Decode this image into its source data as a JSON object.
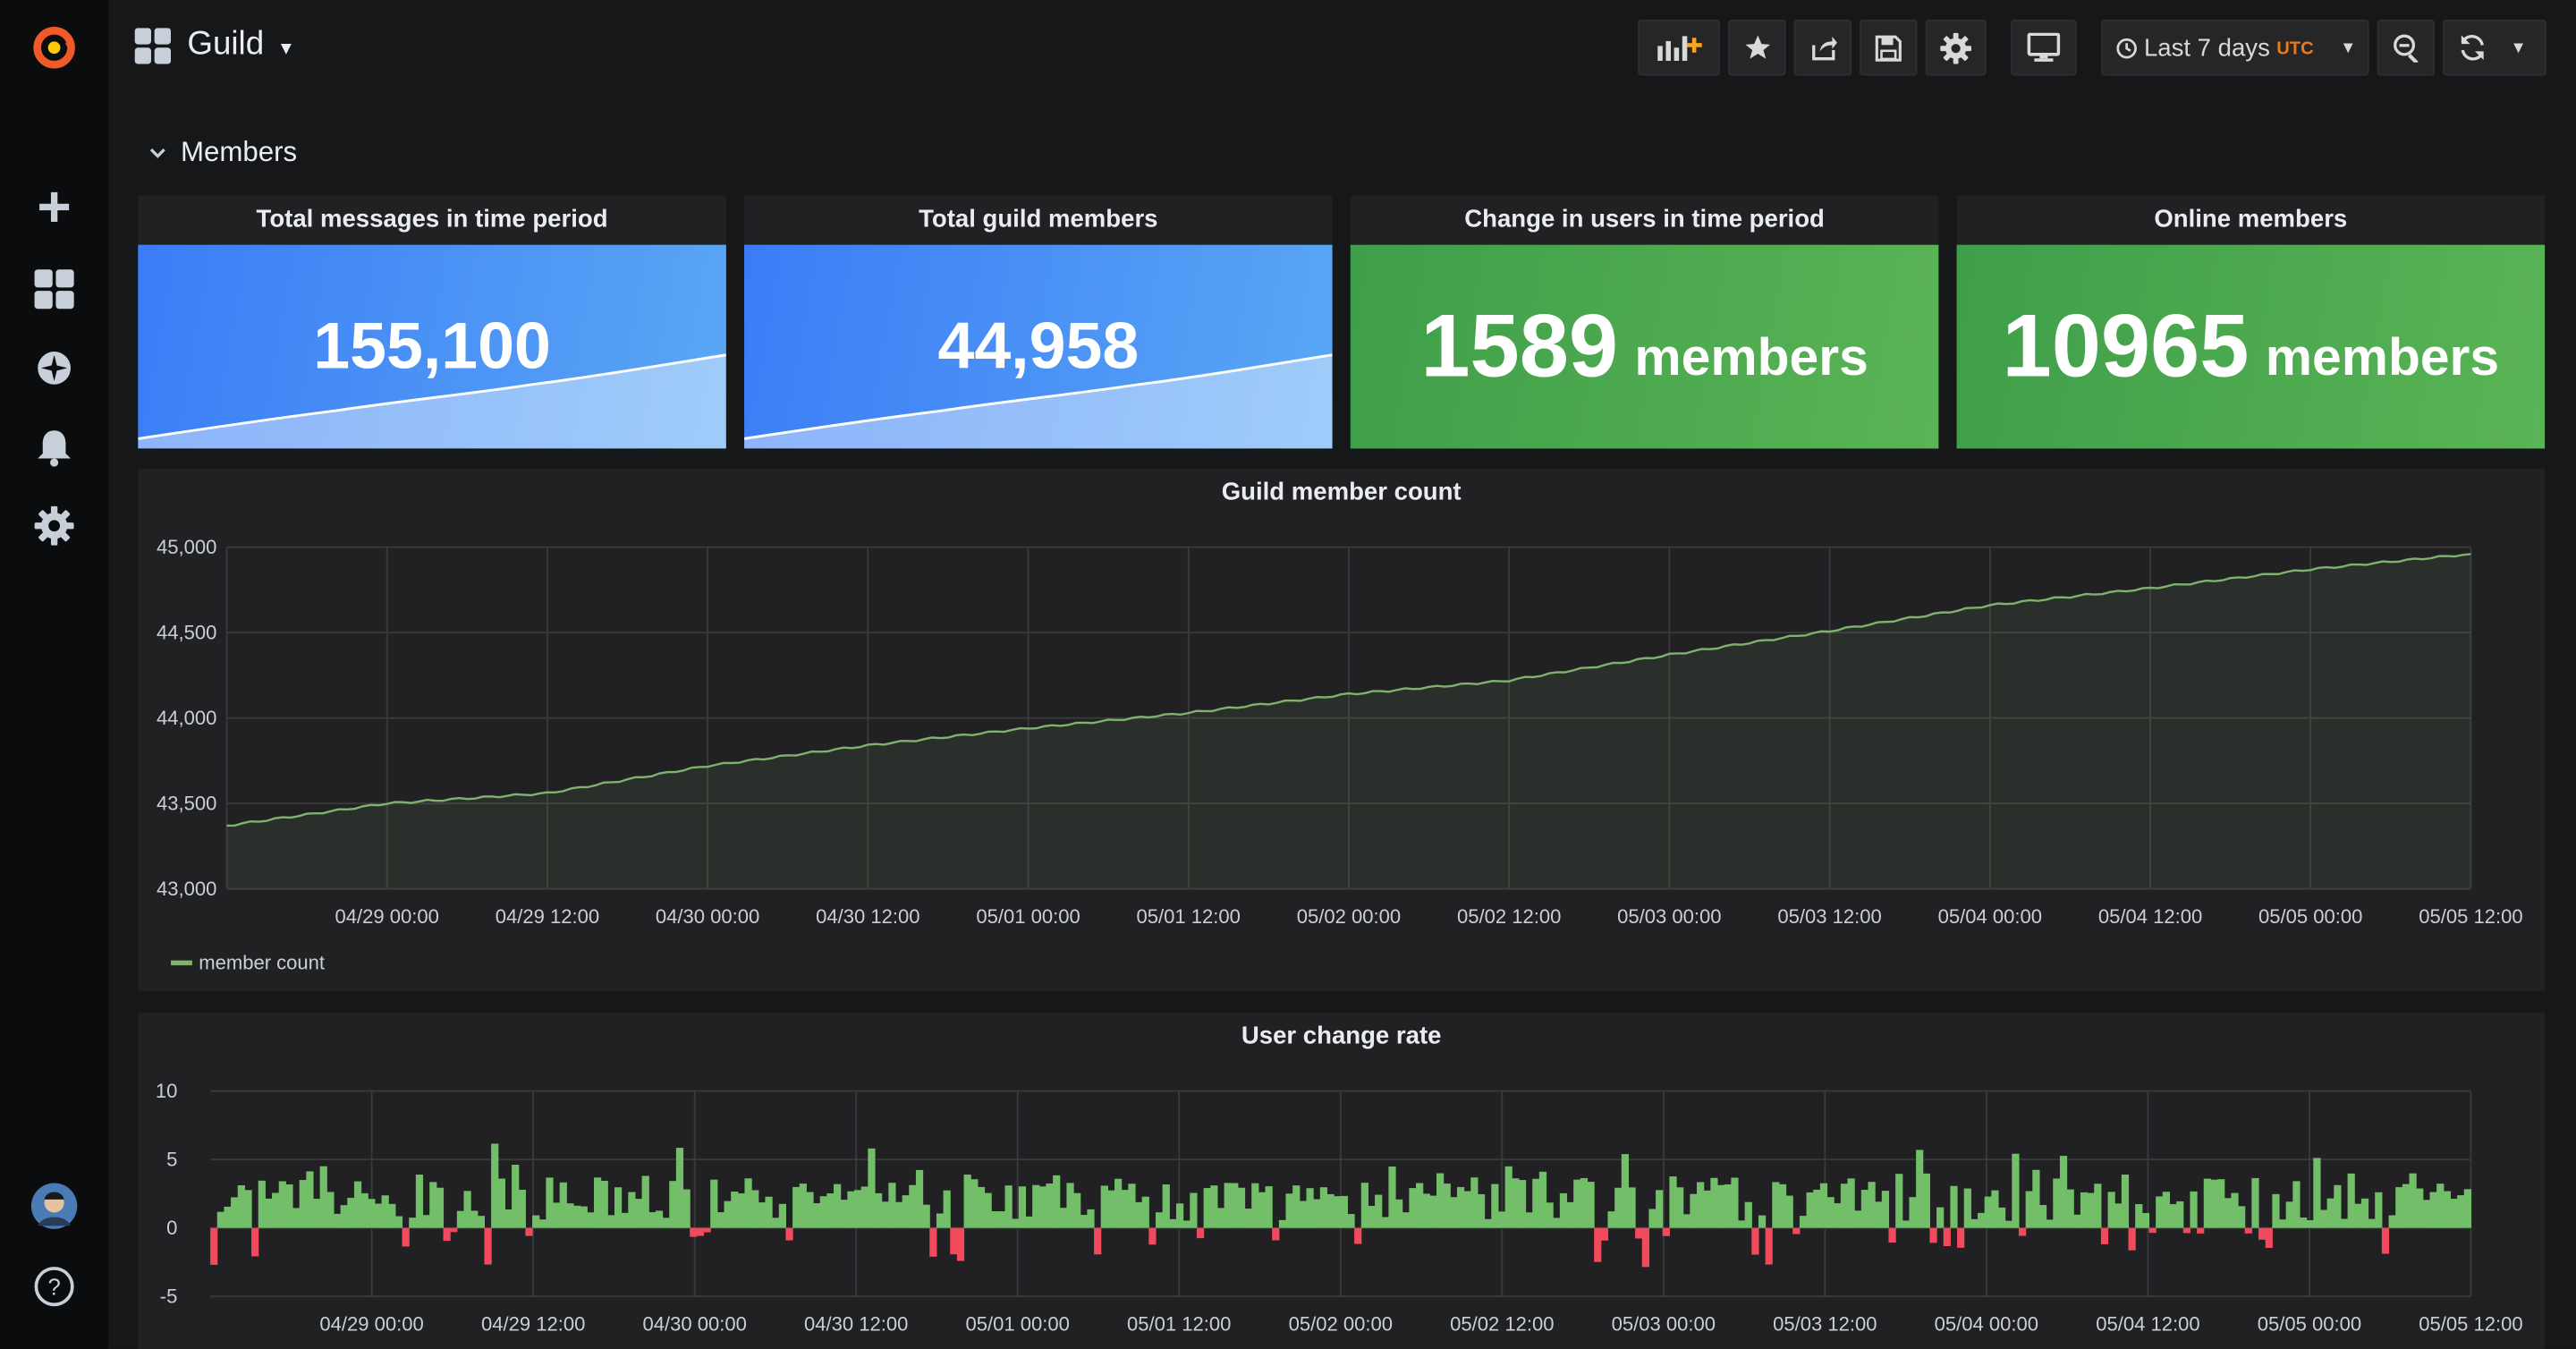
{
  "sidebar": {
    "items": [
      "grafana-logo",
      "create",
      "dashboards",
      "explore",
      "alerting",
      "configuration"
    ],
    "bottom": [
      "user-avatar",
      "help"
    ]
  },
  "header": {
    "dashboard_title": "Guild",
    "time_range": "Last 7 days",
    "timezone": "UTC"
  },
  "row": {
    "title": "Members"
  },
  "stats": [
    {
      "title": "Total messages in time period",
      "value": "155,100",
      "unit": "",
      "color": "#3d7ef5"
    },
    {
      "title": "Total guild members",
      "value": "44,958",
      "unit": "",
      "color": "#3d7ef5"
    },
    {
      "title": "Change in users in time period",
      "value": "1589",
      "unit": "members",
      "color": "#3fa14a"
    },
    {
      "title": "Online members",
      "value": "10965",
      "unit": "members",
      "color": "#3fa14a"
    }
  ],
  "colors": {
    "blue": "#3d7ef5",
    "green": "#3fa14a",
    "series_green": "#7eb26d",
    "negative": "#e02f44"
  },
  "chart_data": [
    {
      "type": "line",
      "title": "Guild member count",
      "x_ticks": [
        "04/29 00:00",
        "04/29 12:00",
        "04/30 00:00",
        "04/30 12:00",
        "05/01 00:00",
        "05/01 12:00",
        "05/02 00:00",
        "05/02 12:00",
        "05/03 00:00",
        "05/03 12:00",
        "05/04 00:00",
        "05/04 12:00",
        "05/05 00:00",
        "05/05 12:00"
      ],
      "y_ticks": [
        "45,000",
        "44,500",
        "44,000",
        "43,500",
        "43,000"
      ],
      "ylim": [
        43000,
        45000
      ],
      "xlim": [
        "04/28 12:00",
        "05/05 12:00"
      ],
      "grid": true,
      "legend": "bottom-left",
      "series": [
        {
          "name": "member count",
          "x": [
            "04/28 12:00",
            "04/29 00:00",
            "04/29 12:00",
            "04/30 00:00",
            "04/30 12:00",
            "05/01 00:00",
            "05/01 12:00",
            "05/02 00:00",
            "05/02 12:00",
            "05/03 00:00",
            "05/03 12:00",
            "05/04 00:00",
            "05/04 12:00",
            "05/05 00:00",
            "05/05 12:00"
          ],
          "values": [
            43370,
            43500,
            43560,
            43720,
            43840,
            43940,
            44030,
            44140,
            44220,
            44370,
            44510,
            44660,
            44760,
            44870,
            44960
          ]
        }
      ]
    },
    {
      "type": "bar",
      "title": "User change rate",
      "x_ticks": [
        "04/29 00:00",
        "04/29 12:00",
        "04/30 00:00",
        "04/30 12:00",
        "05/01 00:00",
        "05/01 12:00",
        "05/02 00:00",
        "05/02 12:00",
        "05/03 00:00",
        "05/03 12:00",
        "05/04 00:00",
        "05/04 12:00",
        "05/05 00:00",
        "05/05 12:00"
      ],
      "y_ticks": [
        "10",
        "5",
        "0",
        "-5"
      ],
      "ylim": [
        -5,
        10
      ],
      "grid": true,
      "series": [
        {
          "name": "",
          "positive_color": "#73bf69",
          "negative_color": "#f2495c",
          "sample_count": 330
        }
      ]
    }
  ]
}
